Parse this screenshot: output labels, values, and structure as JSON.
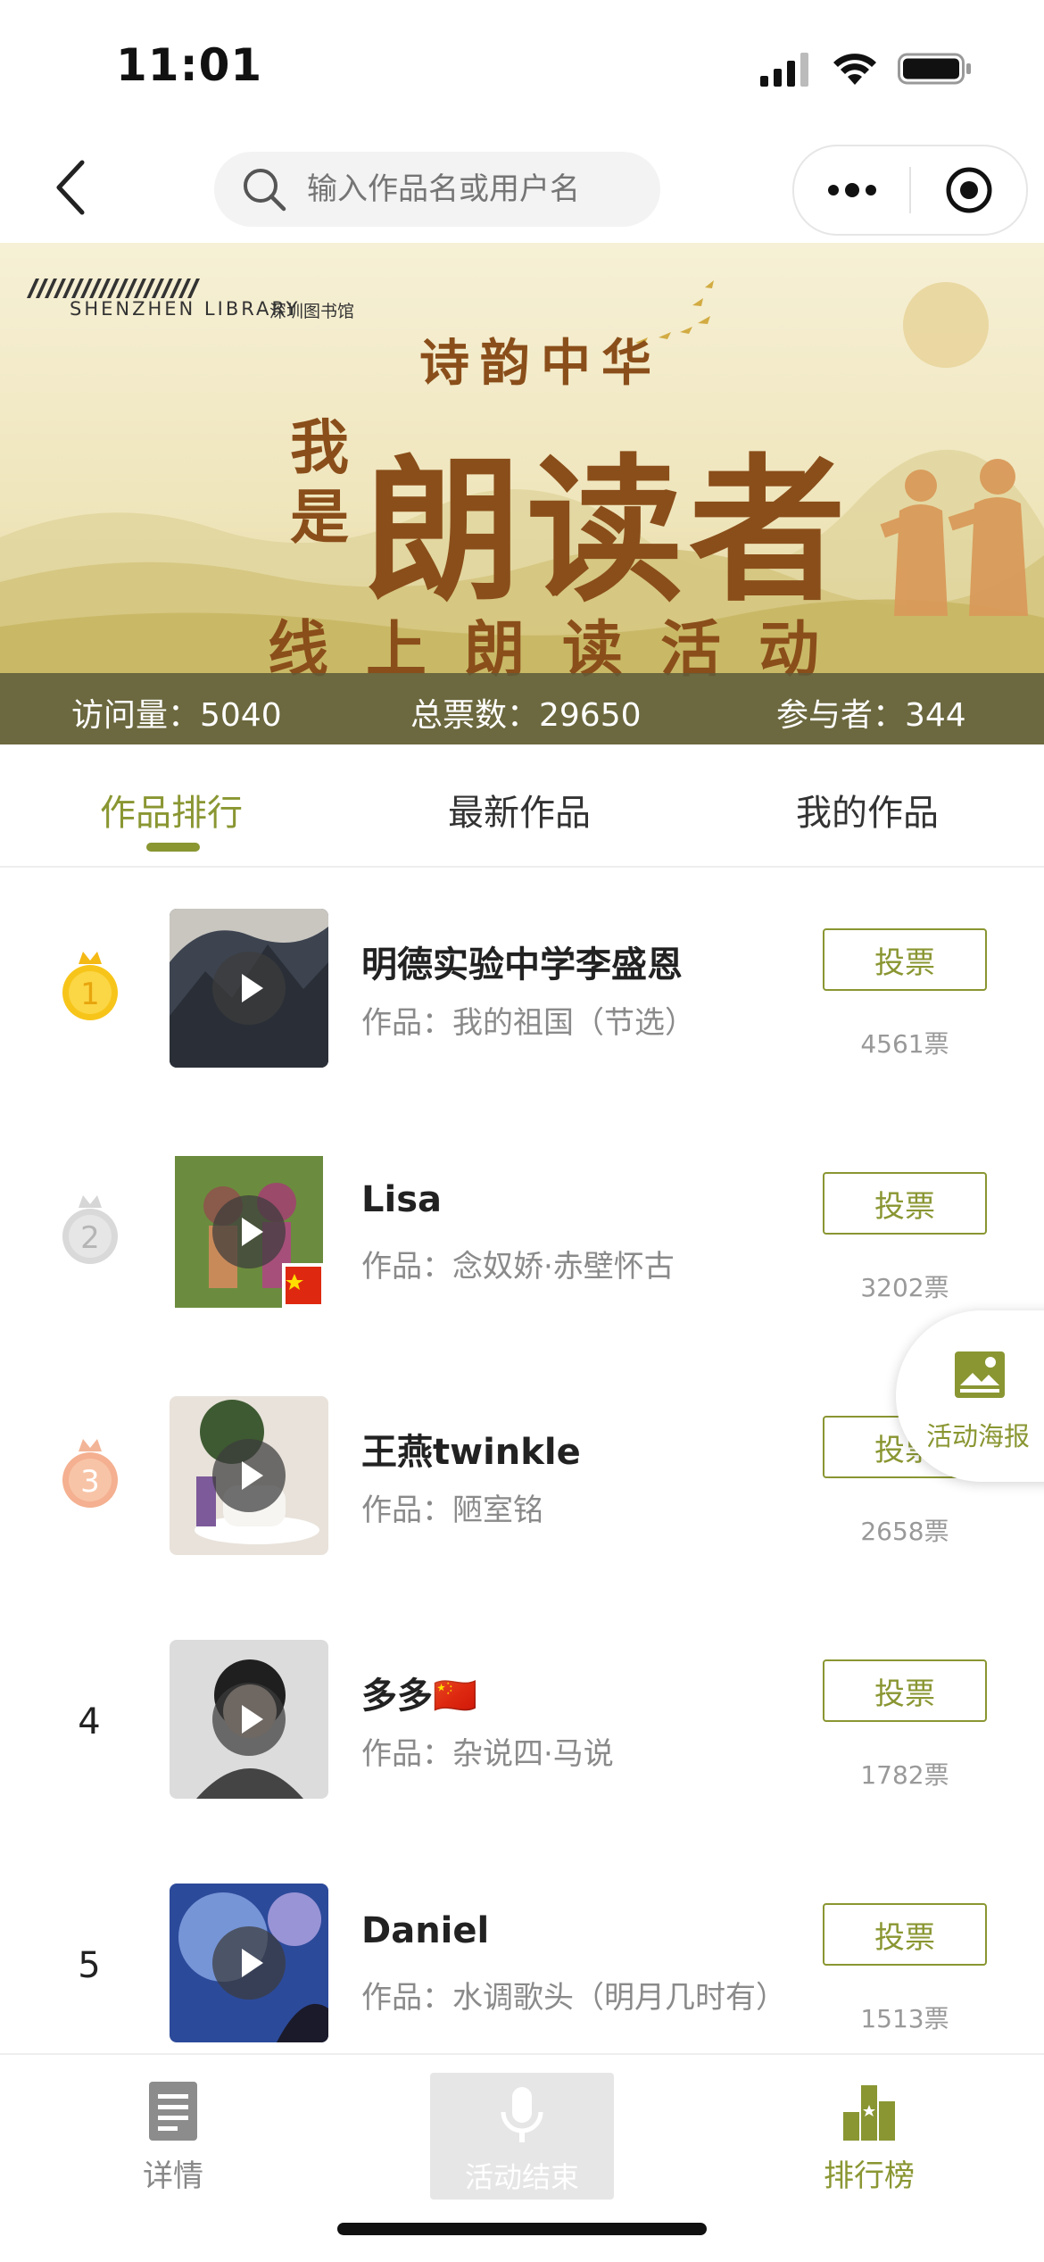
{
  "status_bar": {
    "time": "11:01"
  },
  "navbar": {
    "search_placeholder": "输入作品名或用户名"
  },
  "banner": {
    "library_en": "SHENZHEN LIBRARY",
    "library_cn": "深圳图书馆",
    "subtitle": "诗韵中华",
    "small_title": "我是",
    "main_title": "朗读者",
    "bottom_title": "线上朗读活动",
    "stats": {
      "visits": "访问量：5040",
      "total_votes": "总票数：29650",
      "participants": "参与者：344"
    }
  },
  "tabs": [
    {
      "label": "作品排行",
      "active": true
    },
    {
      "label": "最新作品",
      "active": false
    },
    {
      "label": "我的作品",
      "active": false
    }
  ],
  "colors": {
    "accent": "#8a9632",
    "banner_text": "#8a4e1a",
    "gold": "#f5c518",
    "silver": "#cfcfcf",
    "bronze": "#f0a57e"
  },
  "entries": [
    {
      "rank": "1",
      "medal": "gold",
      "name": "明德实验中学李盛恩",
      "work": "作品：我的祖国（节选）",
      "vote_label": "投票",
      "votes": "4561票"
    },
    {
      "rank": "2",
      "medal": "silver",
      "name": "Lisa",
      "work": "作品：念奴娇·赤壁怀古",
      "vote_label": "投票",
      "votes": "3202票"
    },
    {
      "rank": "3",
      "medal": "bronze",
      "name": "王燕twinkle",
      "work": "作品：陋室铭",
      "vote_label": "投票",
      "votes": "2658票"
    },
    {
      "rank": "4",
      "medal": "",
      "name": "多多🇨🇳",
      "work": "作品：杂说四·马说",
      "vote_label": "投票",
      "votes": "1782票"
    },
    {
      "rank": "5",
      "medal": "",
      "name": "Daniel",
      "work": "作品：水调歌头（明月几时有）",
      "vote_label": "投票",
      "votes": "1513票"
    }
  ],
  "poster_button": {
    "label": "活动海报",
    "icon": "poster-image-icon"
  },
  "bottom_bar": {
    "details": {
      "label": "详情",
      "icon": "document-icon"
    },
    "record": {
      "label": "活动结束",
      "icon": "microphone-icon"
    },
    "ranking": {
      "label": "排行榜",
      "icon": "ranking-podium-icon"
    }
  }
}
